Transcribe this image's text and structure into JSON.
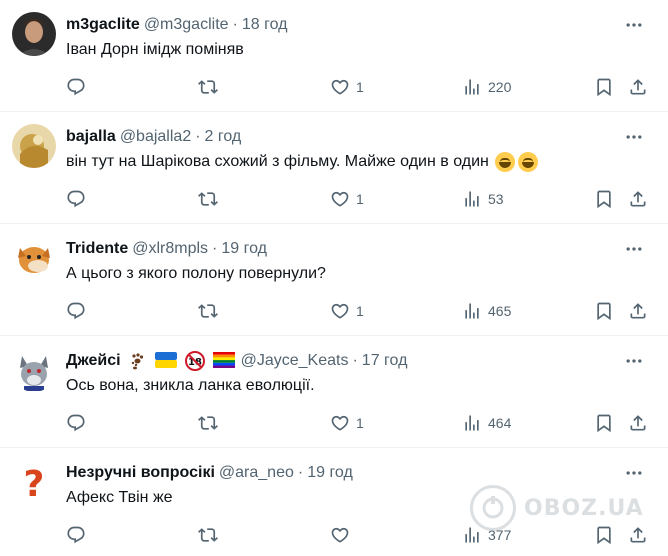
{
  "replies": [
    {
      "name": "m3gaclite",
      "handle": "@m3gaclite",
      "time": "18 год",
      "text": "Іван Дорн імідж поміняв",
      "likes": "1",
      "views": "220"
    },
    {
      "name": "bajalla",
      "handle": "@bajalla2",
      "time": "2 год",
      "text": "він тут на Шарікова  схожий з фільму. Майже один в один",
      "likes": "1",
      "views": "53"
    },
    {
      "name": "Tridente",
      "handle": "@xlr8mpls",
      "time": "19 год",
      "text": "А цього з якого полону повернули?",
      "likes": "1",
      "views": "465"
    },
    {
      "name": "Джейсі",
      "handle": "@Jayce_Keats",
      "time": "17 год",
      "text": "Ось вона, зникла ланка еволюції.",
      "likes": "1",
      "views": "464"
    },
    {
      "name": "Незручні вопросікі",
      "handle": "@ara_neo",
      "time": "19 год",
      "text": "Афекс Твін же",
      "likes": "",
      "views": "377"
    }
  ],
  "separator": "·",
  "watermark": "OBOZ.UA",
  "icons": {
    "reply": "reply-icon",
    "repost": "repost-icon",
    "like": "like-icon",
    "views": "views-icon",
    "bookmark": "bookmark-icon",
    "share": "share-icon",
    "more": "more-icon"
  },
  "colors": {
    "text": "#0f1419",
    "secondary": "#536471",
    "divider": "#eff3f4"
  }
}
